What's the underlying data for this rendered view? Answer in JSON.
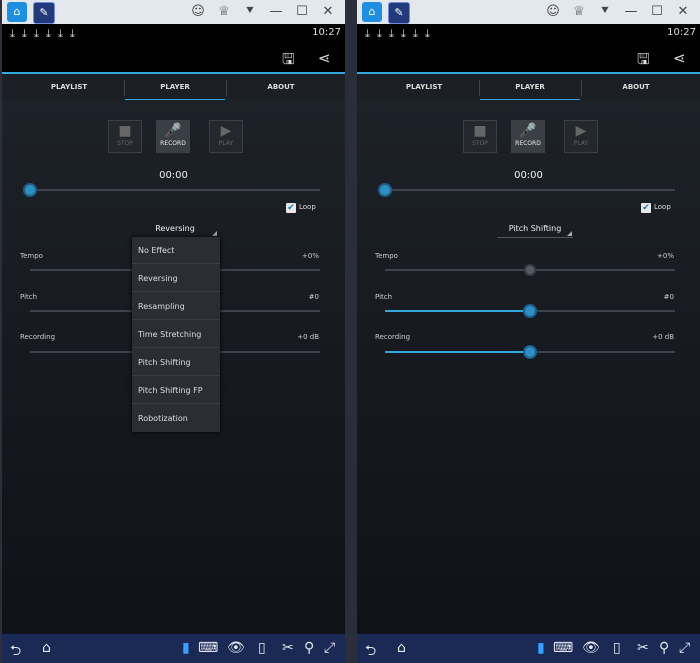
{
  "status": {
    "download_glyphs": [
      "⤓",
      "⤓",
      "⤓",
      "⤓",
      "⤓",
      "⤓"
    ],
    "time": "10:27"
  },
  "bluestacks": {
    "home_glyph": "⌂",
    "app_glyph": "✎",
    "controls": [
      "☺",
      "♕",
      "⯆",
      "—",
      "☐",
      "✕"
    ]
  },
  "actionbar": {
    "save_icon": "save-icon",
    "share_icon": "share-icon",
    "save_glyph": "🖫",
    "share_glyph": "⋖"
  },
  "tabs": [
    "PLAYLIST",
    "PLAYER",
    "ABOUT"
  ],
  "controls": {
    "stop": "STOP",
    "record": "RECORD",
    "play": "PLAY",
    "stop_glyph": "■",
    "record_glyph": "🎤",
    "play_glyph": "▶"
  },
  "timer": "00:00",
  "loop": {
    "label": "Loop",
    "checked": true,
    "check_glyph": "✔"
  },
  "rows": {
    "tempo": "Tempo",
    "tempo_value": "+0%",
    "pitch": "Pitch",
    "pitch_value": "#0",
    "recording": "Recording",
    "recording_value": "+0 dB"
  },
  "left": {
    "effect": "Reversing"
  },
  "right": {
    "effect": "Pitch Shifting"
  },
  "menu": [
    "No Effect",
    "Reversing",
    "Resampling",
    "Time Stretching",
    "Pitch Shifting",
    "Pitch Shifting FP",
    "Robotization"
  ],
  "navbar": {
    "glyphs": [
      "⮌",
      "⌂",
      "▮",
      "⌨",
      "👁",
      "▯",
      "✂",
      "⚲",
      "⤢"
    ]
  },
  "colors": {
    "accent": "#33a8dd",
    "background": "#10131a"
  },
  "levels": {
    "left": {
      "tempo": 0.5
    },
    "right": {
      "tempo": 0.5,
      "pitch": 0.5,
      "recording": 0.5
    }
  }
}
